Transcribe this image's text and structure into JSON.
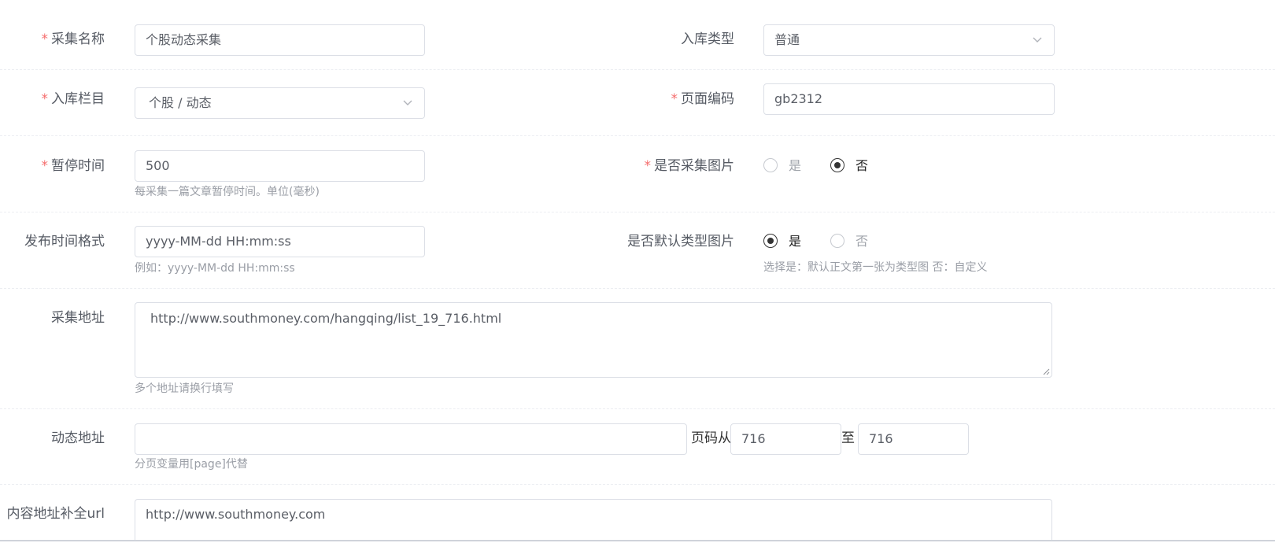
{
  "form": {
    "collect_name": {
      "label": "采集名称",
      "value": "个股动态采集"
    },
    "storage_type": {
      "label": "入库类型",
      "value": "普通"
    },
    "storage_column": {
      "label": "入库栏目",
      "value": "个股 / 动态"
    },
    "page_encoding": {
      "label": "页面编码",
      "value": "gb2312"
    },
    "pause_time": {
      "label": "暂停时间",
      "value": "500",
      "hint": "每采集一篇文章暂停时间。单位(毫秒)"
    },
    "collect_images": {
      "label": "是否采集图片",
      "options": [
        "是",
        "否"
      ],
      "selected": "否"
    },
    "publish_time_format": {
      "label": "发布时间格式",
      "value": "yyyy-MM-dd HH:mm:ss",
      "hint": "例如：yyyy-MM-dd HH:mm:ss"
    },
    "default_type_image": {
      "label": "是否默认类型图片",
      "options": [
        "是",
        "否"
      ],
      "selected": "是",
      "hint": "选择是：默认正文第一张为类型图 否：自定义"
    },
    "collect_url": {
      "label": "采集地址",
      "value": "http://www.southmoney.com/hangqing/list_19_716.html",
      "hint": "多个地址请换行填写"
    },
    "dynamic_url": {
      "label": "动态地址",
      "value": "",
      "page_from_label": "页码从",
      "page_from": "716",
      "page_to_label": "至",
      "page_to": "716",
      "hint": "分页变量用[page]代替"
    },
    "content_url_base": {
      "label": "内容地址补全url",
      "value": "http://www.southmoney.com"
    }
  },
  "icons": {
    "caret": "chevron-down-icon",
    "required": "asterisk"
  },
  "colors": {
    "required": "#f56c6c",
    "border": "#dcdfe6",
    "hint": "#9a9ea6",
    "radio_checked": "#333333"
  }
}
